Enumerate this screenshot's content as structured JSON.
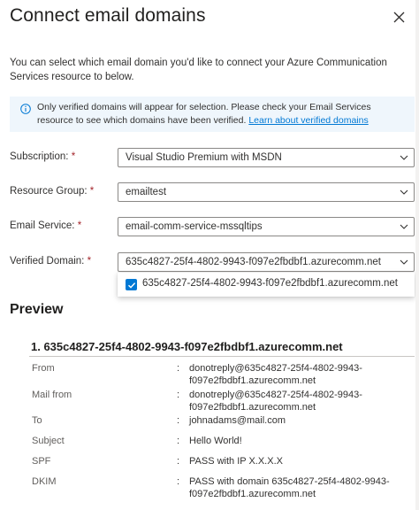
{
  "panel": {
    "title": "Connect email domains",
    "intro": "You can select which email domain you'd like to connect your Azure Communication Services resource to below.",
    "info": {
      "text": "Only verified domains will appear for selection. Please check your Email Services resource to see which domains have been verified.",
      "link": "Learn about verified domains"
    }
  },
  "form": {
    "subscription": {
      "label": "Subscription:",
      "required": "*",
      "value": "Visual Studio Premium with MSDN"
    },
    "resource_group": {
      "label": "Resource Group:",
      "required": "*",
      "value": "emailtest"
    },
    "email_service": {
      "label": "Email Service:",
      "required": "*",
      "value": "email-comm-service-mssqltips"
    },
    "verified_domain": {
      "label": "Verified Domain:",
      "required": "*",
      "value": "635c4827-25f4-4802-9943-f097e2fbdbf1.azurecomm.net",
      "options": [
        {
          "label": "635c4827-25f4-4802-9943-f097e2fbdbf1.azurecomm.net",
          "checked": true
        }
      ]
    }
  },
  "preview": {
    "heading": "Preview",
    "domain_title": "1. 635c4827-25f4-4802-9943-f097e2fbdbf1.azurecomm.net",
    "rows": [
      {
        "key": "From",
        "value_line1": "donotreply@635c4827-25f4-4802-9943-",
        "value_line2": "f097e2fbdbf1.azurecomm.net"
      },
      {
        "key": "Mail from",
        "value_line1": "donotreply@635c4827-25f4-4802-9943-",
        "value_line2": "f097e2fbdbf1.azurecomm.net"
      },
      {
        "key": "To",
        "value_line1": "johnadams@mail.com",
        "value_line2": ""
      },
      {
        "key": "Subject",
        "value_line1": "Hello World!",
        "value_line2": ""
      },
      {
        "key": "SPF",
        "value_line1": "PASS with IP X.X.X.X",
        "value_line2": ""
      },
      {
        "key": "DKIM",
        "value_line1": "PASS with domain 635c4827-25f4-4802-9943-",
        "value_line2": "f097e2fbdbf1.azurecomm.net"
      }
    ]
  },
  "colors": {
    "accent": "#0078d4",
    "info_background": "#eff6fc",
    "required": "#a4262c"
  },
  "icons": {
    "close": "close-icon",
    "info": "info-icon",
    "chevron": "chevron-down-icon",
    "check": "checkmark-icon"
  }
}
